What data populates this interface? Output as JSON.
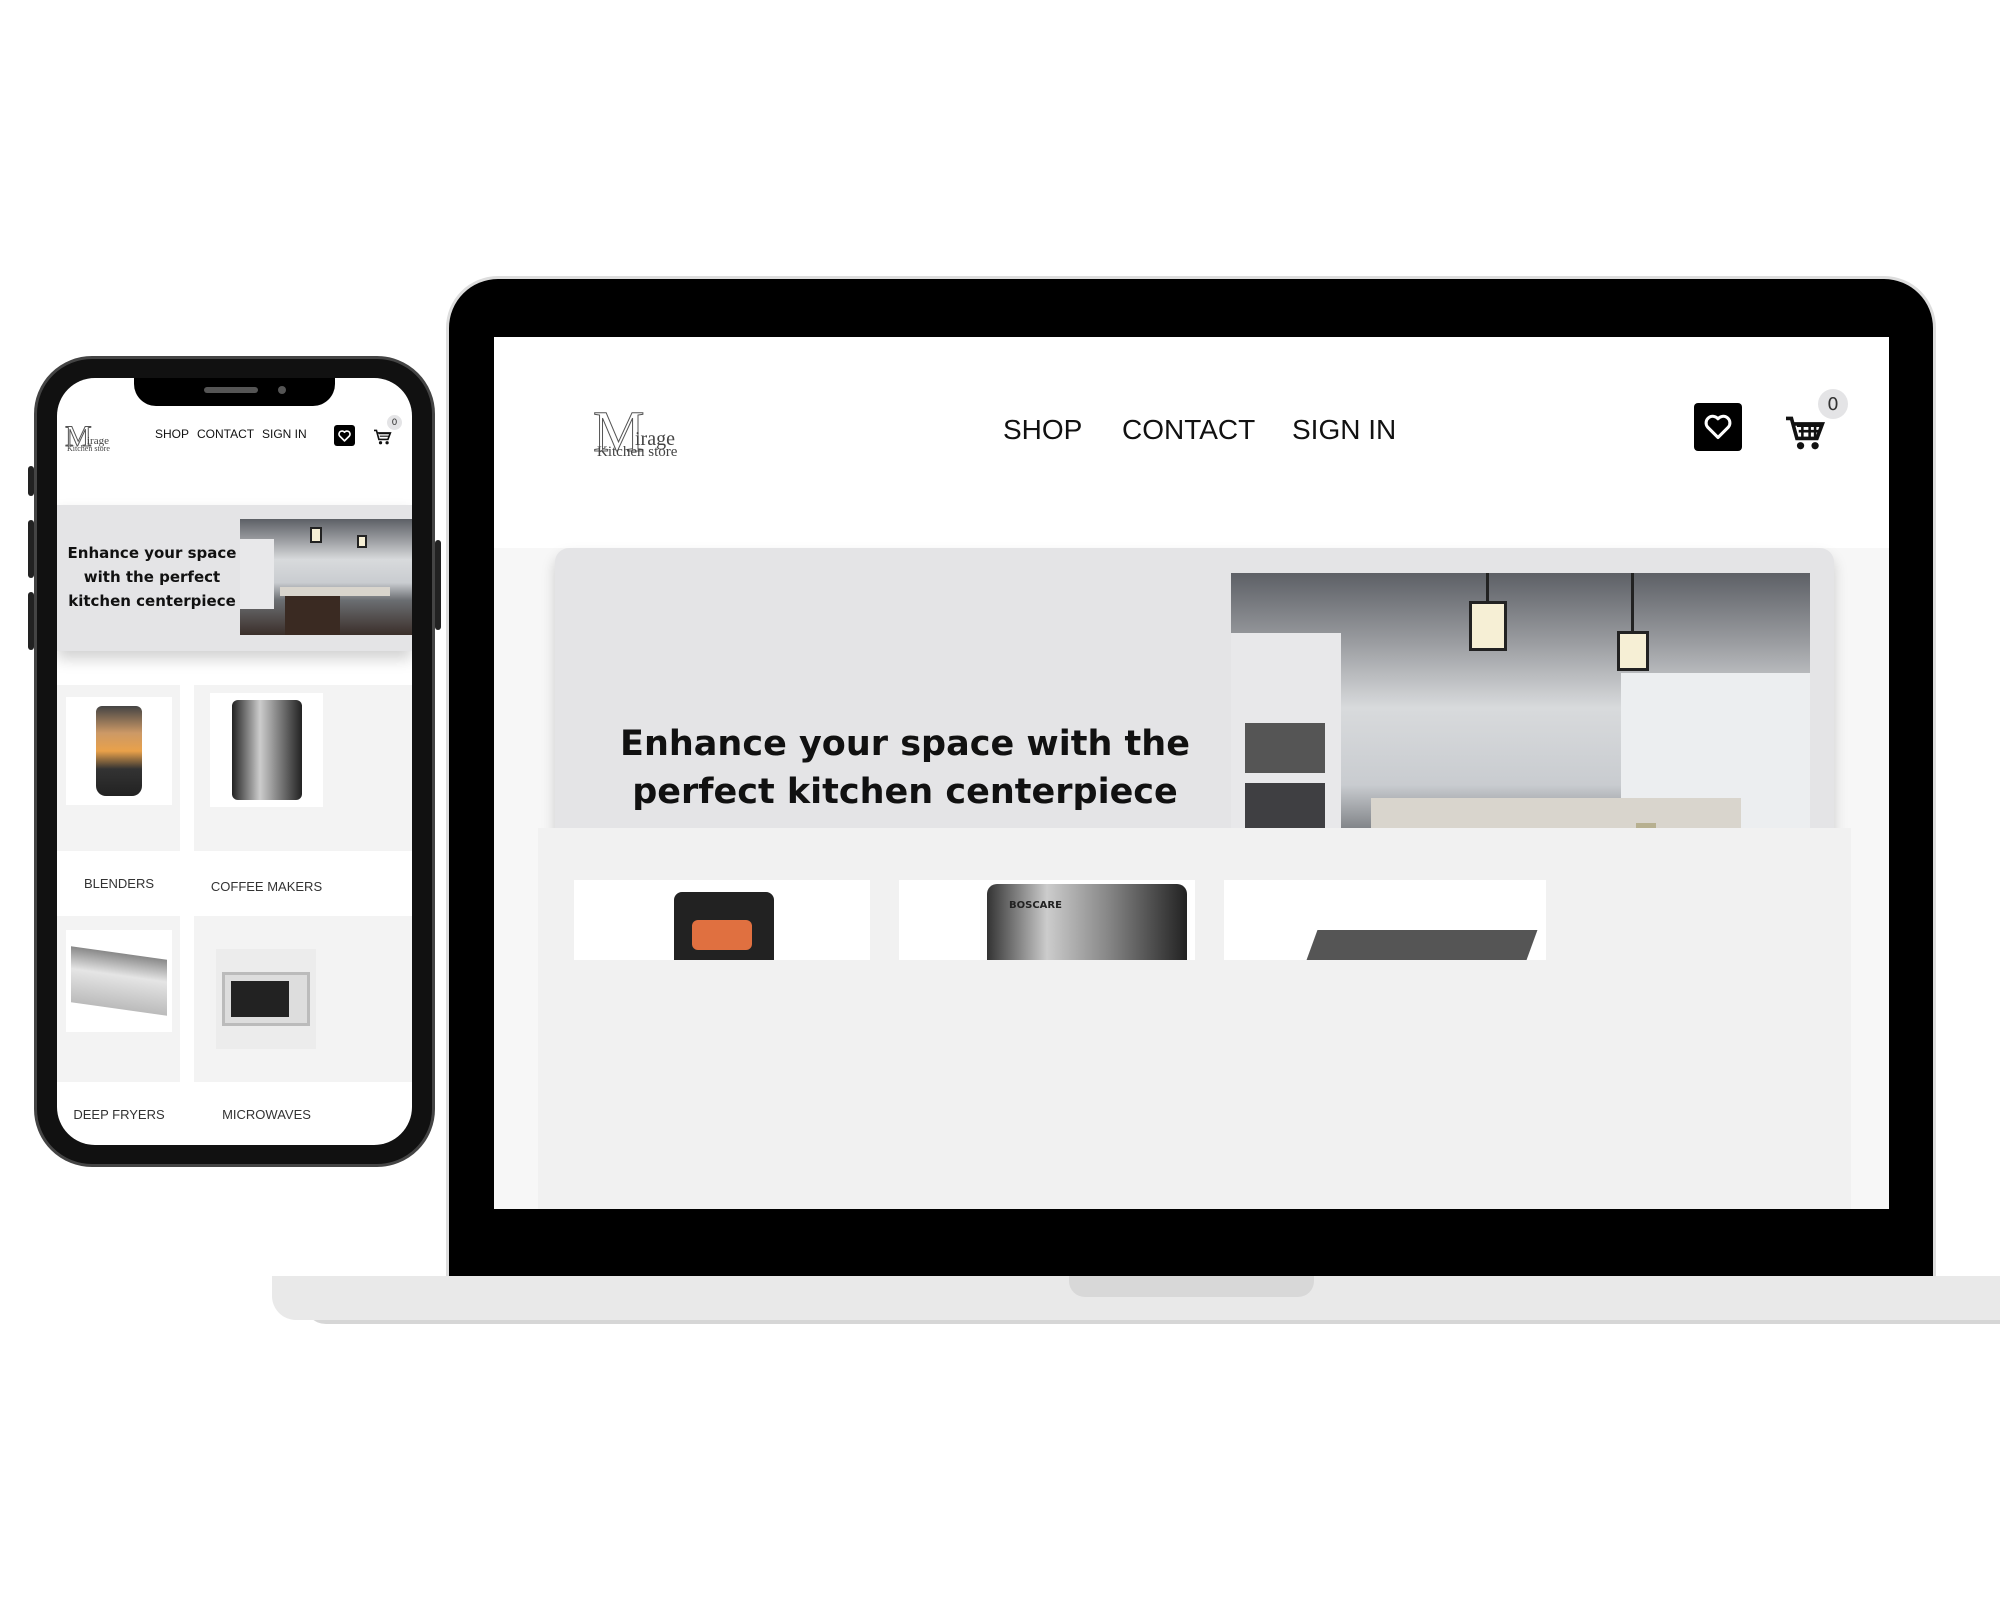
{
  "brand": {
    "logo_initial": "M",
    "logo_rest": "irage",
    "logo_sub": "Kitchen store"
  },
  "nav": {
    "shop": "SHOP",
    "contact": "CONTACT",
    "sign_in": "SIGN IN"
  },
  "cart": {
    "count": "0"
  },
  "hero": {
    "headline": "Enhance your space with the perfect kitchen centerpiece"
  },
  "categories": [
    {
      "label": "BLENDERS"
    },
    {
      "label": "COFFEE MAKERS"
    },
    {
      "label": "DEEP FRYERS"
    },
    {
      "label": "MICROWAVES"
    }
  ],
  "product_preview": {
    "coffee_brand": "BOSCARE"
  },
  "colors": {
    "hero_bg": "#e4e4e6",
    "accent": "#000000"
  }
}
